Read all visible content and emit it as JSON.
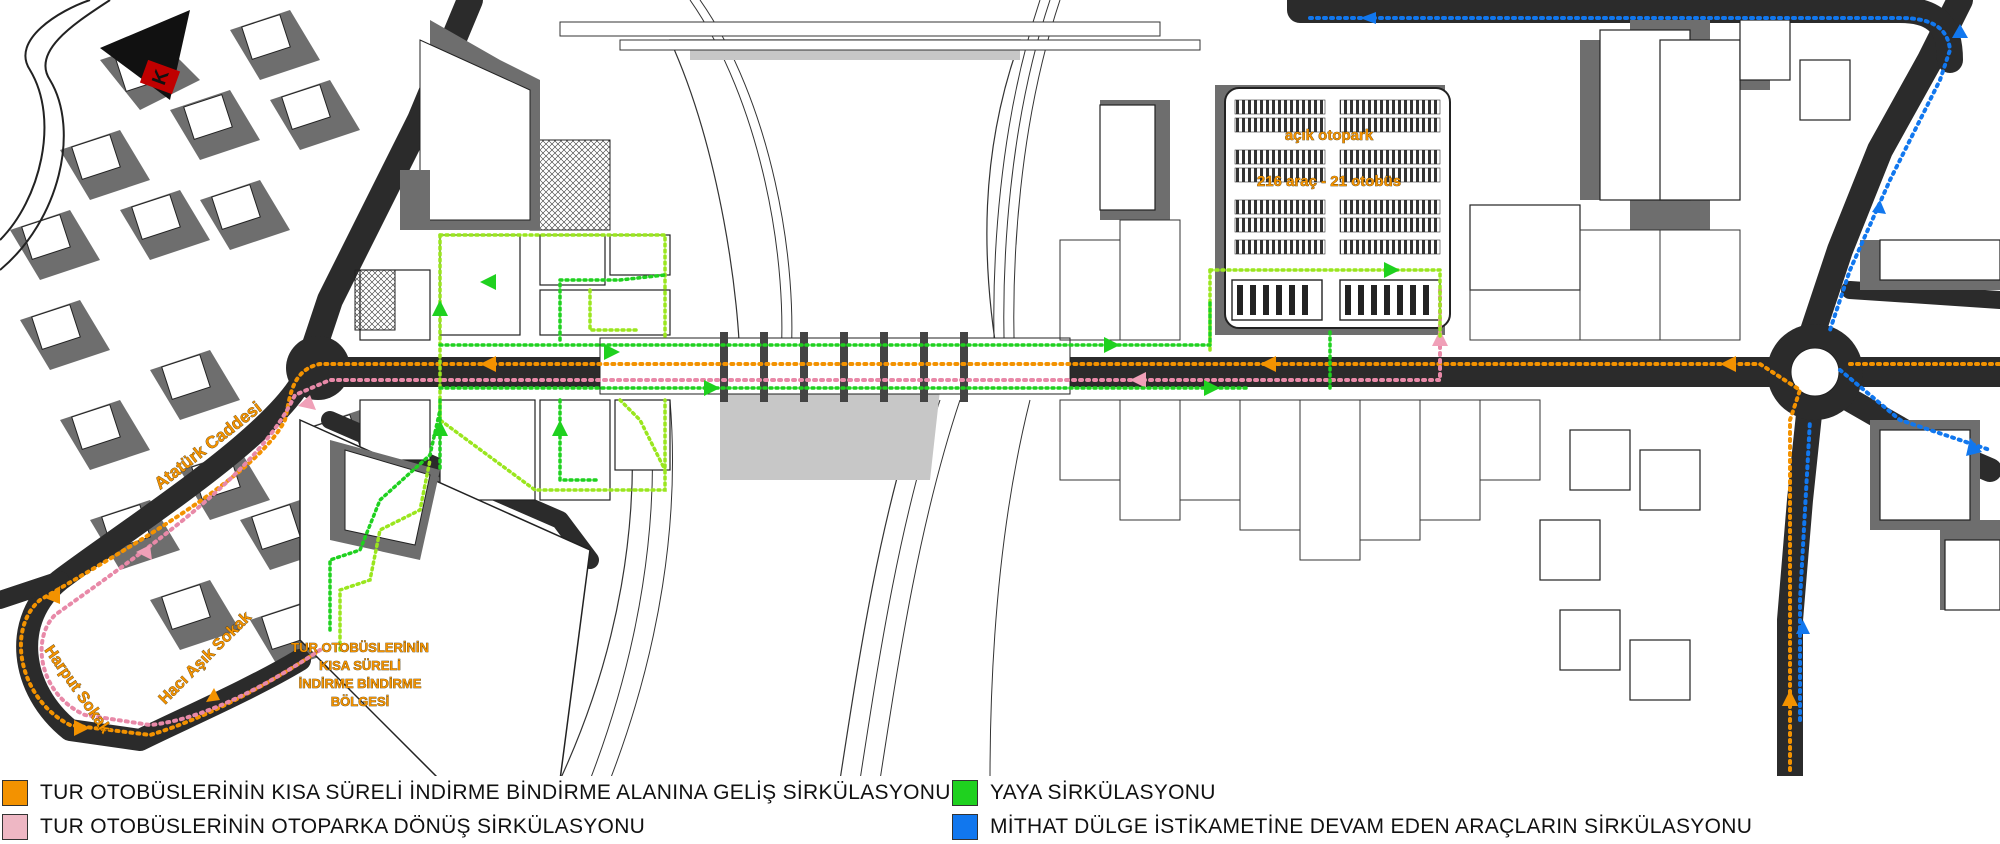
{
  "north_arrow": {
    "letter": "K"
  },
  "map_labels": {
    "parking_title": "açık otopark",
    "parking_capacity": "216 araç - 21 otobüs",
    "street_ataturk": "Atatürk Caddesi",
    "street_harput": "Harput Sokak",
    "street_haci_asik": "Hacı Aşık Sokak",
    "dropoff_zone_lines": [
      "TUR OTOBÜSLERİNİN",
      "KISA SÜRELİ",
      "İNDİRME BİNDİRME",
      "BÖLGESİ"
    ]
  },
  "legend": [
    {
      "label": "TUR OTOBÜSLERİNİN KISA SÜRELİ İNDİRME BİNDİRME ALANINA GELİŞ SİRKÜLASYONU",
      "color": "#f39200"
    },
    {
      "label": "TUR OTOBÜSLERİNİN OTOPARKA DÖNÜŞ SİRKÜLASYONU",
      "color": "#eeb7c4"
    },
    {
      "label": "YAYA SİRKÜLASYONU",
      "color": "#1fd11f"
    },
    {
      "label": "MİTHAT DÜLGE İSTİKAMETİNE DEVAM EDEN ARAÇLARIN SİRKÜLASYONU",
      "color": "#1177ee"
    }
  ],
  "colors": {
    "road": "#2b2b2b",
    "building_shadow": "#6e6e6e",
    "building": "#ffffff",
    "orange_route": "#f39200",
    "pink_route": "#e889a8",
    "green_route": "#1fd11f",
    "lightgreen_route": "#9ae61e",
    "blue_route": "#1177ee"
  }
}
